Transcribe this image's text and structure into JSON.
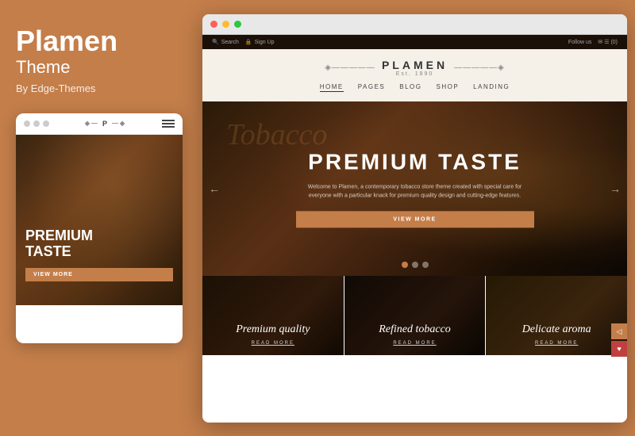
{
  "leftPanel": {
    "title": "Plamen",
    "subtitle": "Theme",
    "author": "By Edge-Themes"
  },
  "mobilePreview": {
    "dots": [
      "dot1",
      "dot2",
      "dot3"
    ],
    "logoText": "P",
    "logoPrefix": "◈—",
    "logoSuffix": "—◈",
    "heroTitle": "PREMIUM\nTASTE",
    "viewMoreLabel": "VIEW MORE",
    "navDots": [
      "active",
      "inactive",
      "inactive"
    ]
  },
  "browserPreview": {
    "topbar": {
      "searchLabel": "Search",
      "signupLabel": "Sign Up",
      "followLabel": "Follow us",
      "cartLabel": "(0)"
    },
    "header": {
      "logoDecoLeft": "◈—————",
      "brandName": "PLAMEN",
      "est": "Est. 1890",
      "logoDecoRight": "—————◈",
      "nav": [
        {
          "label": "HOME",
          "active": true
        },
        {
          "label": "PAGES",
          "active": false
        },
        {
          "label": "BLOG",
          "active": false
        },
        {
          "label": "SHOP",
          "active": false
        },
        {
          "label": "LANDING",
          "active": false
        }
      ]
    },
    "hero": {
      "scriptText": "Tobacco",
      "title": "PREMIUM TASTE",
      "description": "Welcome to Plamen, a contemporary tobacco store theme created with special care for everyone with a particular knack for premium quality design and cutting-edge features.",
      "viewMoreLabel": "VIEW MORE",
      "navDots": [
        "active",
        "inactive",
        "inactive"
      ]
    },
    "featureCards": [
      {
        "title": "Premium quality",
        "readMore": "READ MORE"
      },
      {
        "title": "Refined tobacco",
        "readMore": "READ MORE"
      },
      {
        "title": "Delicate aroma",
        "readMore": "READ MORE"
      }
    ]
  }
}
